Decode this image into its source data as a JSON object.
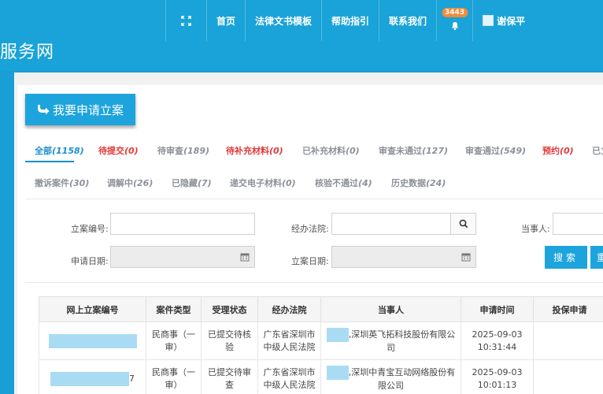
{
  "header": {
    "brand": "服务网",
    "nav": [
      {
        "label": "首页"
      },
      {
        "label": "法律文书模板"
      },
      {
        "label": "帮助指引"
      },
      {
        "label": "联系我们"
      }
    ],
    "notification_count": "3443",
    "user_name": "谢保平"
  },
  "apply_button": "我要申请立案",
  "tabs": [
    {
      "label": "全部",
      "count": "(1158)"
    },
    {
      "label": "待提交",
      "count": "(0)"
    },
    {
      "label": "待审查",
      "count": "(189)"
    },
    {
      "label": "待补充材料",
      "count": "(0)"
    },
    {
      "label": "已补充材料",
      "count": "(0)"
    },
    {
      "label": "审查未通过",
      "count": "(127)"
    },
    {
      "label": "审查通过",
      "count": "(549)"
    },
    {
      "label": "预约",
      "count": "(0)"
    },
    {
      "label": "已立",
      "count": ""
    },
    {
      "label": "撤诉案件",
      "count": "(30)"
    },
    {
      "label": "调解中",
      "count": "(26)"
    },
    {
      "label": "已隐藏",
      "count": "(7)"
    },
    {
      "label": "递交电子材料",
      "count": "(0)"
    },
    {
      "label": "核验不通过",
      "count": "(4)"
    },
    {
      "label": "历史数据",
      "count": "(24)"
    }
  ],
  "search": {
    "case_no_label": "立案编号:",
    "court_label": "经办法院:",
    "party_label": "当事人:",
    "apply_date_label": "申请日期:",
    "filing_date_label": "立案日期:",
    "search_button": "搜索",
    "reset_button": "重"
  },
  "table": {
    "columns": [
      "网上立案编号",
      "案件类型",
      "受理状态",
      "经办法院",
      "当事人",
      "申请时间",
      "投保申请"
    ],
    "rows": [
      {
        "case_no_suffix": "",
        "case_type": "民商事（一审）",
        "status": "已提交待核验",
        "court": "广东省深圳市中级人民法院",
        "party": ",深圳英飞拓科技股份有限公司",
        "time": "2025-09-03 10:31:44"
      },
      {
        "case_no_suffix": "7",
        "case_type": "民商事（一审）",
        "status": "已提交待审查",
        "court": "广东省深圳市中级人民法院",
        "party": ",深圳中青宝互动网络股份有限公司",
        "time": "2025-09-03 10:01:13"
      }
    ]
  },
  "colors": {
    "header_bg": "#19a3d8",
    "accent": "#1a8fd0",
    "red_tab": "#e03a3a",
    "badge": "#f08c3a"
  }
}
